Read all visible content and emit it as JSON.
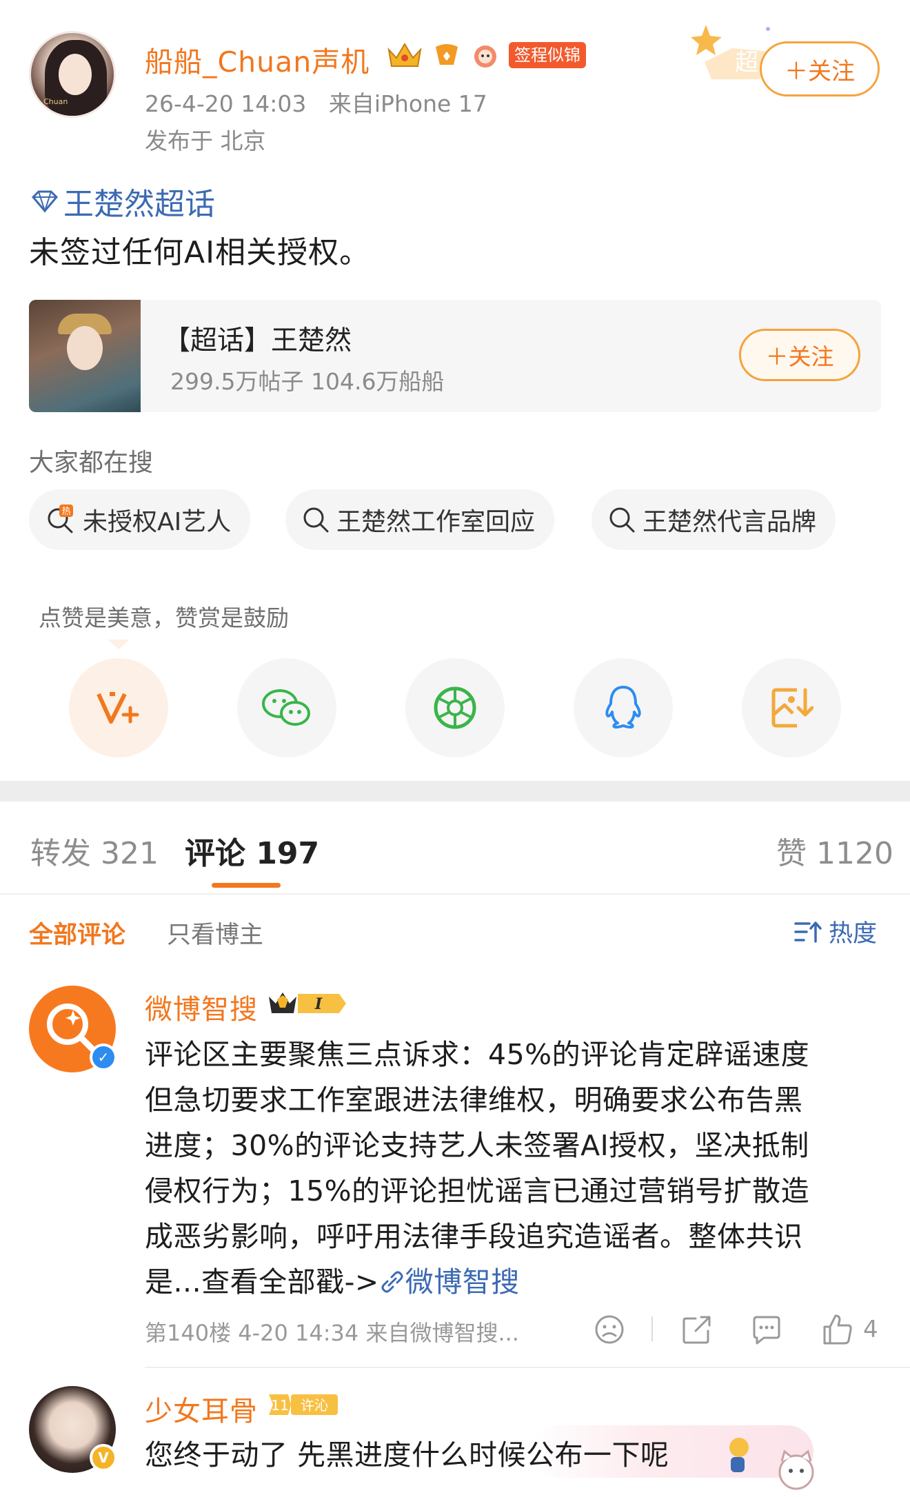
{
  "post": {
    "username": "船船_Chuan声机",
    "badge_tag": "签程似锦",
    "timestamp": "26-4-20 14:03",
    "source": "来自iPhone 17",
    "location": "发布于 北京",
    "follow_label": "＋关注",
    "super_deco": "超",
    "topic_link": "王楚然超话",
    "text": "未签过任何AI相关授权。"
  },
  "topic_card": {
    "title": "【超话】王楚然",
    "stats": "299.5万帖子 104.6万船船",
    "follow_label": "＋关注"
  },
  "search": {
    "title": "大家都在搜",
    "chips": [
      "未授权AI艺人",
      "王楚然工作室回应",
      "王楚然代言品牌"
    ]
  },
  "reward": {
    "text": "点赞是美意，赞赏是鼓励"
  },
  "share_icons": [
    "vip-reward-icon",
    "wechat-icon",
    "moments-icon",
    "qq-icon",
    "save-image-icon"
  ],
  "tabs": {
    "repost": "转发 321",
    "comment": "评论 197",
    "like": "赞 1120"
  },
  "filters": {
    "all": "全部评论",
    "author_only": "只看博主",
    "sort": "热度"
  },
  "comments": [
    {
      "name": "微博智搜",
      "level": "I",
      "body_lines": [
        "评论区主要聚焦三点诉求：45%的评论肯定辟谣速度",
        "但急切要求工作室跟进法律维权，明确要求公布告黑",
        "进度；30%的评论支持艺人未签署AI授权，坚决抵制",
        "侵权行为；15%的评论担忧谣言已通过营销号扩散造",
        "成恶劣影响，呼吁用法律手段追究造谣者。整体共识"
      ],
      "body_last": "是...查看全部戳->",
      "link_text": "微博智搜",
      "meta": "第140楼 4-20 14:34 来自微博智搜...",
      "likes": "4"
    },
    {
      "name": "少女耳骨",
      "level": "11",
      "badge": "许沁",
      "body": "您终于动了 先黑进度什么时候公布一下呢"
    }
  ],
  "colors": {
    "accent": "#f2771e",
    "link": "#3c6ab3",
    "muted": "#8a8a8a"
  }
}
